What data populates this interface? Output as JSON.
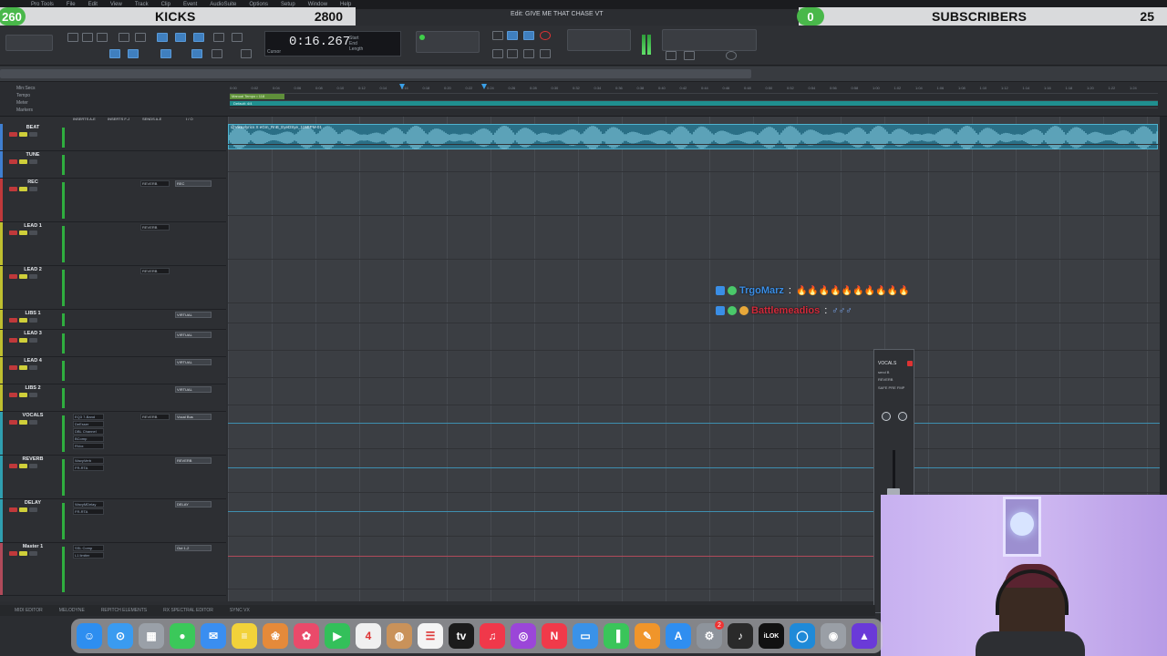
{
  "menubar": {
    "items": [
      "Pro Tools",
      "File",
      "Edit",
      "View",
      "Track",
      "Clip",
      "Event",
      "AudioSuite",
      "Options",
      "Setup",
      "Window",
      "Help"
    ]
  },
  "window_title": "Edit: GIVE ME THAT CHASE VT",
  "overlay_left": {
    "badge": "260",
    "title": "KICKS",
    "value": "2800"
  },
  "overlay_right": {
    "badge": "0",
    "title": "SUBSCRIBERS",
    "value": "25"
  },
  "counter": {
    "time": "0:16.267",
    "label": "Cursor"
  },
  "rulers": {
    "labels": [
      "Min:Secs",
      "Tempo",
      "Meter",
      "Markers"
    ],
    "tempo": "Manual Tempo • 118",
    "meter": "Default: 4/4",
    "ticks": [
      "0:00",
      "0:02",
      "0:04",
      "0:06",
      "0:08",
      "0:10",
      "0:12",
      "0:14",
      "0:16",
      "0:18",
      "0:20",
      "0:22",
      "0:24",
      "0:26",
      "0:28",
      "0:30",
      "0:32",
      "0:34",
      "0:36",
      "0:38",
      "0:40",
      "0:42",
      "0:44",
      "0:46",
      "0:48",
      "0:50",
      "0:52",
      "0:54",
      "0:56",
      "0:58",
      "1:00",
      "1:02",
      "1:04",
      "1:06",
      "1:08",
      "1:10",
      "1:12",
      "1:14",
      "1:16",
      "1:18",
      "1:20",
      "1:22",
      "1:24"
    ]
  },
  "columns": [
    "INSERTS A-E",
    "INSERTS F-J",
    "SENDS A-E",
    "I / O"
  ],
  "tracks": [
    {
      "name": "BEAT",
      "color": "#3f7fd0",
      "send": "",
      "io": "",
      "inserts": []
    },
    {
      "name": "TUNE",
      "color": "#3f7fd0",
      "send": "",
      "io": "",
      "inserts": []
    },
    {
      "name": "REC",
      "color": "#c0393b",
      "send": "REVERB",
      "io": "REC",
      "inserts": []
    },
    {
      "name": "LEAD 1",
      "color": "#bfbf2f",
      "send": "REVERB",
      "io": "",
      "inserts": []
    },
    {
      "name": "LEAD 2",
      "color": "#bfbf2f",
      "send": "REVERB",
      "io": "",
      "inserts": []
    },
    {
      "name": "LIBS 1",
      "color": "#bfbf2f",
      "send": "",
      "io": "VIRTUAL",
      "inserts": []
    },
    {
      "name": "LEAD 3",
      "color": "#bfbf2f",
      "send": "",
      "io": "VIRTUAL",
      "inserts": []
    },
    {
      "name": "LEAD 4",
      "color": "#bfbf2f",
      "send": "",
      "io": "VIRTUAL",
      "inserts": []
    },
    {
      "name": "LIBS 2",
      "color": "#bfbf2f",
      "send": "",
      "io": "VIRTUAL",
      "inserts": []
    },
    {
      "name": "VOCALS",
      "color": "#2f9fb0",
      "send": "REVERB",
      "io": "Vocal Bus",
      "inserts": [
        "EQ3 7-Band",
        "DeEsser",
        "DBL Channel",
        "BComp",
        "RVox"
      ]
    },
    {
      "name": "REVERB",
      "color": "#2f9fb0",
      "send": "",
      "io": "REVERB",
      "inserts": [
        "WavyVerb",
        "FR-RTA"
      ]
    },
    {
      "name": "DELAY",
      "color": "#2f9fb0",
      "send": "",
      "io": "DELAY",
      "inserts": [
        "WavyMDelay",
        "FR-RTA"
      ]
    },
    {
      "name": "Master 1",
      "color": "#b04a5a",
      "send": "",
      "io": "Out 1-2",
      "inserts": [
        "SSL Comp",
        "L1 limiter"
      ]
    }
  ],
  "clip": {
    "name": "@Viktorlyrics X eGm_RnB_EyeDSye_118BPM-01"
  },
  "chat": [
    {
      "user": "TrgoMarz",
      "sep": ":",
      "message": "🔥🔥🔥🔥🔥🔥🔥🔥🔥🔥",
      "user_color": "#3a8ee6"
    },
    {
      "user": "Battlemeadios",
      "sep": ":",
      "message": "♂♂♂",
      "user_color": "#d02a3a"
    }
  ],
  "plugin": {
    "title": "VOCALS",
    "row1": "send B",
    "row2": "REVERB",
    "row3": "SAFE PRE FMP"
  },
  "bottom_tabs": [
    "MIDI EDITOR",
    "MELODYNE",
    "REPITCH ELEMENTS",
    "RX SPECTRAL EDITOR",
    "SYNC VX"
  ],
  "dock": [
    {
      "name": "finder-icon",
      "color": "#2d8ef0",
      "glyph": "☺"
    },
    {
      "name": "safari-icon",
      "color": "#3a9bf0",
      "glyph": "⊙"
    },
    {
      "name": "launchpad-icon",
      "color": "#9aa0a8",
      "glyph": "▦"
    },
    {
      "name": "messages-icon",
      "color": "#3bc85a",
      "glyph": "●"
    },
    {
      "name": "mail-icon",
      "color": "#3a8ef0",
      "glyph": "✉"
    },
    {
      "name": "notes-icon",
      "color": "#f2d23a",
      "glyph": "≡"
    },
    {
      "name": "photos-icon",
      "color": "#e58a3a",
      "glyph": "❀"
    },
    {
      "name": "photos-alt-icon",
      "color": "#ea4a6a",
      "glyph": "✿"
    },
    {
      "name": "facetime-icon",
      "color": "#33c05a",
      "glyph": "▶"
    },
    {
      "name": "calendar-icon",
      "color": "#f0f0f0",
      "glyph": "4"
    },
    {
      "name": "contacts-icon",
      "color": "#c9925a",
      "glyph": "◍"
    },
    {
      "name": "reminders-icon",
      "color": "#f4f4f4",
      "glyph": "☰"
    },
    {
      "name": "tv-icon",
      "color": "#1b1b1b",
      "glyph": "tv"
    },
    {
      "name": "music-icon",
      "color": "#f0384a",
      "glyph": "♫"
    },
    {
      "name": "podcasts-icon",
      "color": "#9b46d8",
      "glyph": "◎"
    },
    {
      "name": "news-icon",
      "color": "#f03a4a",
      "glyph": "N"
    },
    {
      "name": "keynote-icon",
      "color": "#3a92e8",
      "glyph": "▭"
    },
    {
      "name": "numbers-icon",
      "color": "#3ac55a",
      "glyph": "▐"
    },
    {
      "name": "pages-icon",
      "color": "#f0952a",
      "glyph": "✎"
    },
    {
      "name": "appstore-icon",
      "color": "#2f8ef0",
      "glyph": "A"
    },
    {
      "name": "settings-icon",
      "color": "#8e949c",
      "glyph": "⚙"
    },
    {
      "name": "logic-icon",
      "color": "#2a2a2a",
      "glyph": "♪"
    },
    {
      "name": "ilok-icon",
      "color": "#111111",
      "glyph": "iLOK"
    },
    {
      "name": "circle-app-icon",
      "color": "#1f8ad8",
      "glyph": "◯"
    },
    {
      "name": "disk-icon",
      "color": "#9a9fa6",
      "glyph": "◉"
    },
    {
      "name": "protools-icon",
      "color": "#6a3ad8",
      "glyph": "▲"
    }
  ],
  "dock_badge": "2",
  "colors": {
    "accent": "#3f7fbf",
    "clip": "#2a6f86",
    "green": "#49b84a"
  }
}
